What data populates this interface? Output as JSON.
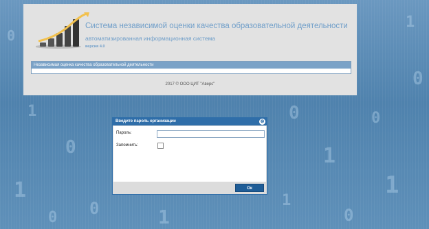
{
  "header": {
    "title": "Система независимой оценки качества образовательной деятельности",
    "subtitle": "автоматизированная информационная система",
    "version": "версия 4.0"
  },
  "nav": {
    "label": "Независимая оценка качества образовательной деятельности"
  },
  "footer": {
    "copyright": "2017 © ООО ЦИТ \"Аверс\""
  },
  "dialog": {
    "title": "Введите пароль организации",
    "password_label": "Пароль:",
    "password_value": "",
    "remember_label": "Запомнить:",
    "remember_checked": false,
    "ok_label": "Ок"
  },
  "colors": {
    "accent": "#2f6ea9",
    "title": "#6f9ec9"
  }
}
